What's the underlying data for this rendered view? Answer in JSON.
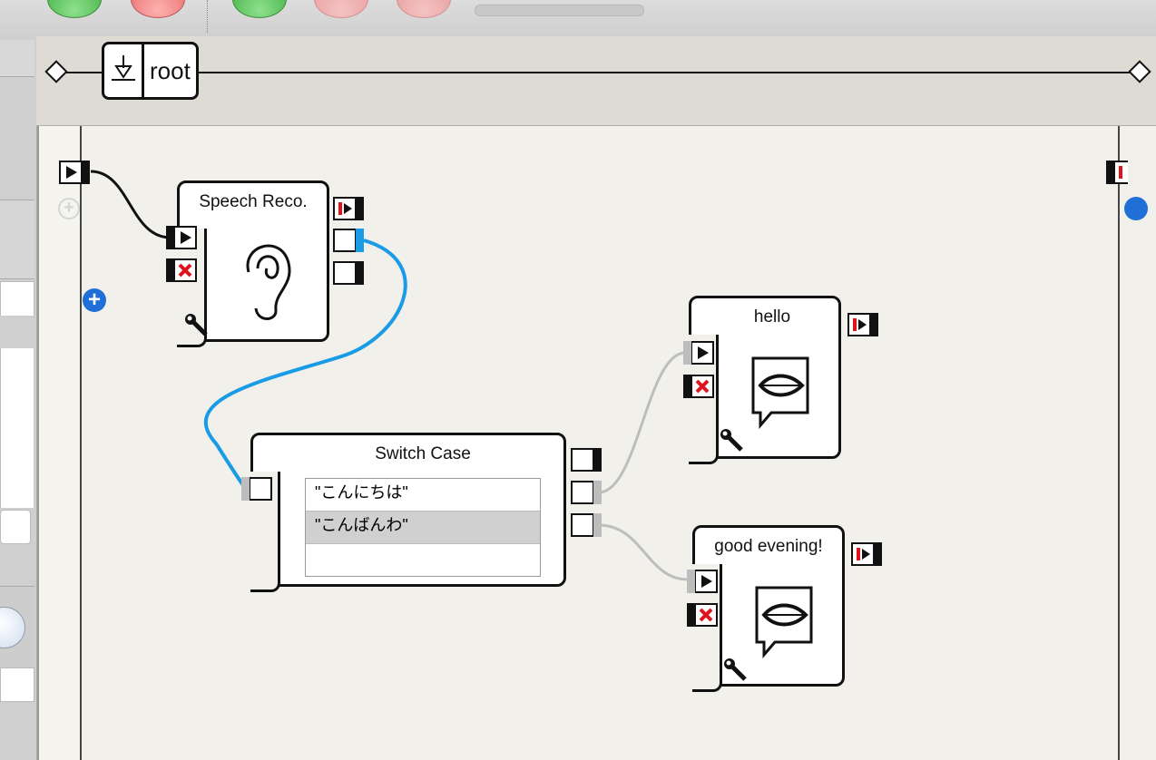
{
  "breadcrumb": {
    "root_label": "root"
  },
  "boxes": {
    "speech_reco": {
      "title": "Speech Reco."
    },
    "switch_case": {
      "title": "Switch Case",
      "cases": [
        "\"こんにちは\"",
        "\"こんばんわ\"",
        ""
      ],
      "selected_index": 1
    },
    "hello": {
      "title": "hello"
    },
    "good_evening": {
      "title": "good evening!"
    }
  },
  "colors": {
    "active_wire": "#1a9be6",
    "inactive_wire": "#bdbdbd",
    "plus_blue": "#1f6fd6",
    "stop_red": "#e0121b"
  }
}
